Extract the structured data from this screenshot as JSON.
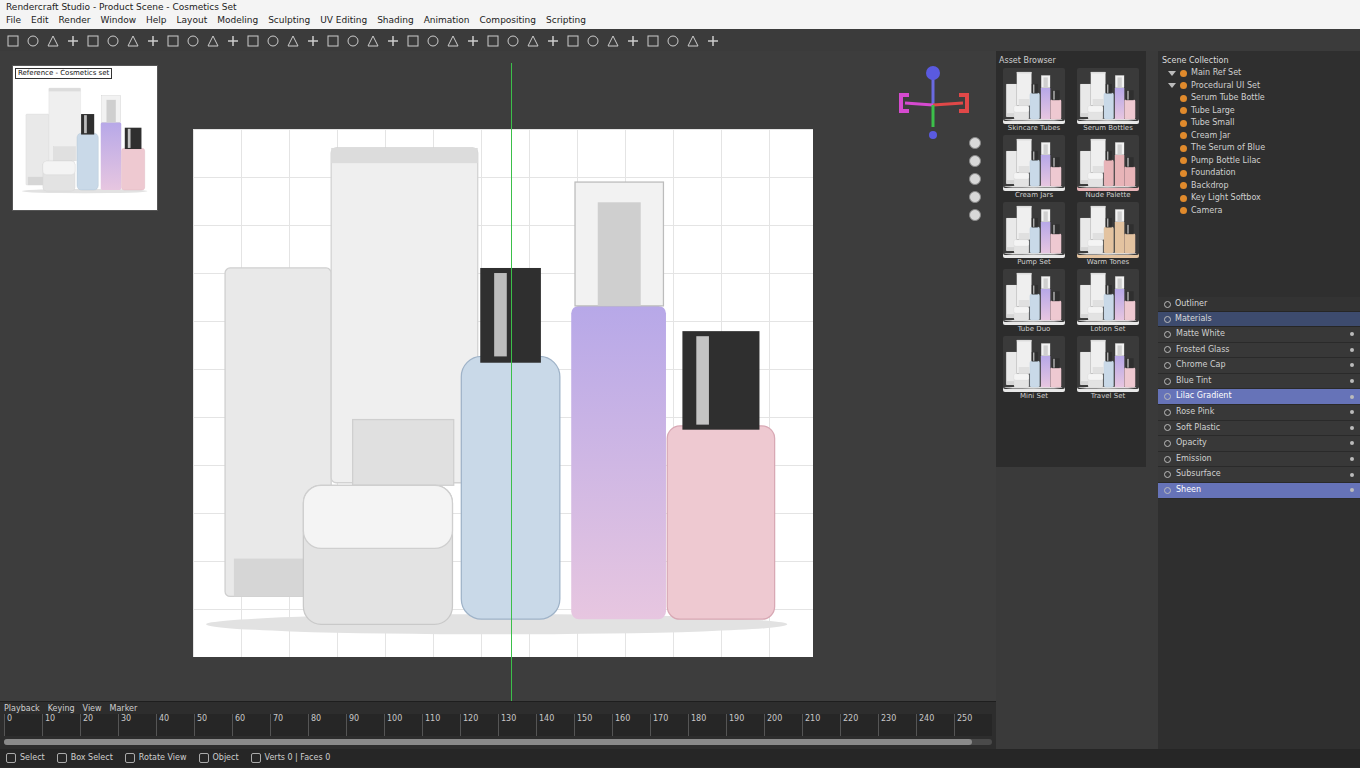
{
  "window": {
    "title": "Rendercraft Studio - Product Scene - Cosmetics Set"
  },
  "menu": [
    "File",
    "Edit",
    "Render",
    "Window",
    "Help",
    "Layout",
    "Modeling",
    "Sculpting",
    "UV Editing",
    "Shading",
    "Animation",
    "Compositing",
    "Scripting"
  ],
  "preview": {
    "label": "Reference - Cosmetics set"
  },
  "assets": {
    "title": "Asset Browser",
    "items": [
      {
        "label": "Skincare Tubes",
        "color": "#e8e8e8"
      },
      {
        "label": "Serum Bottles",
        "color": "#e8e8e8"
      },
      {
        "label": "Cream Jars",
        "color": "#e8e8e8"
      },
      {
        "label": "Nude Palette",
        "color": "#e8b4b8"
      },
      {
        "label": "Pump Set",
        "color": "#e8e8e8"
      },
      {
        "label": "Warm Tones",
        "color": "#e3c3a0"
      },
      {
        "label": "Tube Duo",
        "color": "#e8e8e8"
      },
      {
        "label": "Lotion Set",
        "color": "#e8e8e8"
      },
      {
        "label": "Mini Set",
        "color": "#e8e8e8"
      },
      {
        "label": "Travel Set",
        "color": "#e8e8e8"
      }
    ]
  },
  "outliner": {
    "title": "Scene Collection",
    "items": [
      {
        "label": "Main Ref Set",
        "kind": "group"
      },
      {
        "label": "Procedural UI Set",
        "kind": "group"
      },
      {
        "label": "Serum Tube Bottle",
        "kind": "item"
      },
      {
        "label": "Tube Large",
        "kind": "item"
      },
      {
        "label": "Tube Small",
        "kind": "item"
      },
      {
        "label": "Cream Jar",
        "kind": "item"
      },
      {
        "label": "The Serum of Blue",
        "kind": "item"
      },
      {
        "label": "Pump Bottle Lilac",
        "kind": "item"
      },
      {
        "label": "Foundation",
        "kind": "item"
      },
      {
        "label": "Backdrop",
        "kind": "item"
      },
      {
        "label": "Key Light Softbox",
        "kind": "item"
      },
      {
        "label": "Camera",
        "kind": "item"
      }
    ]
  },
  "properties": {
    "tabs": [
      {
        "label": "Outliner",
        "selected": false
      },
      {
        "label": "Materials",
        "selected": true
      }
    ],
    "rows": [
      {
        "label": "Matte White",
        "selected": false
      },
      {
        "label": "Frosted Glass",
        "selected": false
      },
      {
        "label": "Chrome Cap",
        "selected": false
      },
      {
        "label": "Blue Tint",
        "selected": false
      },
      {
        "label": "Lilac Gradient",
        "selected": true
      },
      {
        "label": "Rose Pink",
        "selected": false
      },
      {
        "label": "Soft Plastic",
        "selected": false
      },
      {
        "label": "Opacity",
        "selected": false
      },
      {
        "label": "Emission",
        "selected": false
      },
      {
        "label": "Subsurface",
        "selected": false
      },
      {
        "label": "Sheen",
        "selected": true
      }
    ]
  },
  "timeline": {
    "menu": [
      "Playback",
      "Keying",
      "View",
      "Marker"
    ],
    "ticks": [
      "0",
      "10",
      "20",
      "30",
      "40",
      "50",
      "60",
      "70",
      "80",
      "90",
      "100",
      "110",
      "120",
      "130",
      "140",
      "150",
      "160",
      "170",
      "180",
      "190",
      "200",
      "210",
      "220",
      "230",
      "240",
      "250"
    ],
    "level": 0.98
  },
  "status_bar": [
    "Select",
    "Box Select",
    "Rotate View",
    "Object",
    "Verts 0 | Faces 0"
  ]
}
